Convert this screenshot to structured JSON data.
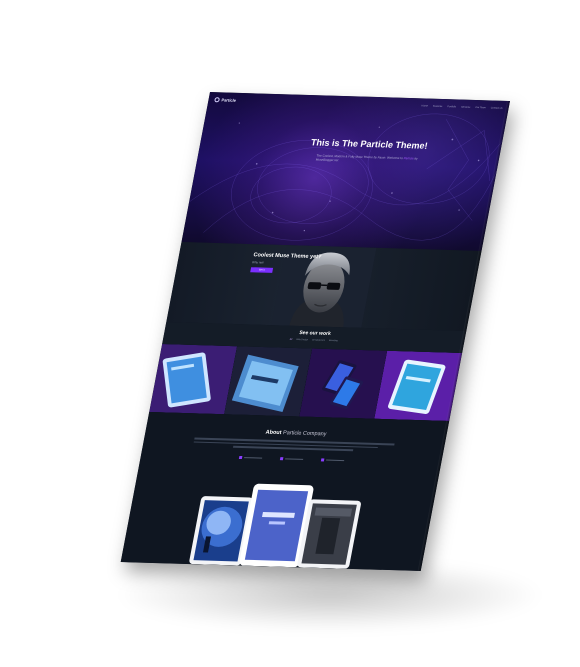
{
  "nav": {
    "logo": "Particle",
    "links": [
      "Home",
      "Features",
      "Portfolio",
      "Services",
      "Our Team",
      "Contact Us"
    ]
  },
  "hero": {
    "title": "This is The Particle Theme!",
    "subtitle_prefix": "The Coolest, Modern & Fully Muse Theme by Nicon. Welcome to",
    "subtitle_link": "Particle",
    "subtitle_suffix": "by MuseBlogger.net"
  },
  "muse": {
    "title": "Coolest Muse Theme yet?",
    "subtitle": "Why not!",
    "button_label": "Get it"
  },
  "work": {
    "title": "See our work",
    "filters": [
      "All",
      "Web Design",
      "Development",
      "Branding"
    ]
  },
  "about": {
    "title_bold": "About",
    "title_light": "Particle Company"
  },
  "colors": {
    "accent": "#7b2fff",
    "background": "#0f1621",
    "hero": "#1e1064"
  }
}
